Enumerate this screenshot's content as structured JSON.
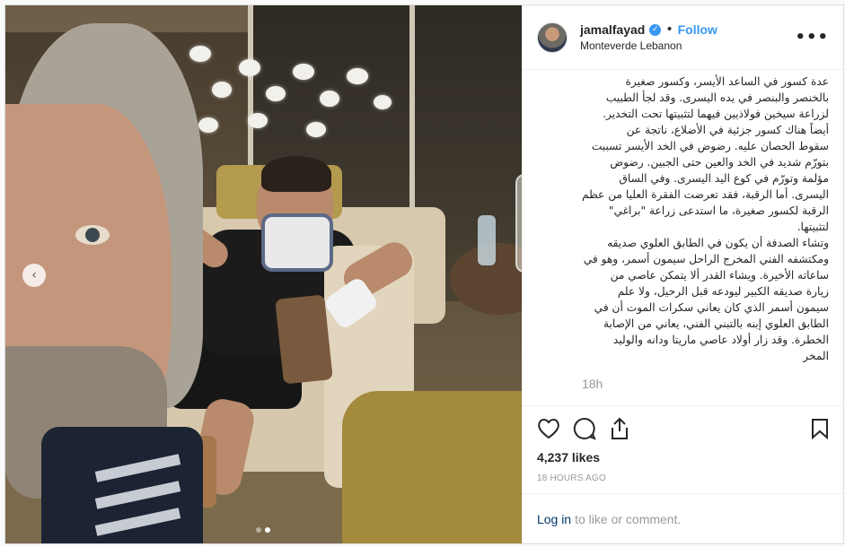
{
  "post": {
    "username": "jamalfayad",
    "verified_icon": "verified-badge-icon",
    "separator": "•",
    "follow_label": "Follow",
    "location": "Monteverde Lebanon",
    "more_label": "•••"
  },
  "media": {
    "prev_arrow": "‹",
    "carousel_dots": 2,
    "active_dot": 2
  },
  "caption": {
    "lines": [
      "عدة كسور في الساعد الأيسر، وكسور صغيرة",
      "بالخنصر والبنصر في يده اليسرى. وقد لجأ الطبيب",
      "لزراعة سيخين فولاذيين فيهما لتثبيتها تحت التخدير.",
      "أيضاً هناك كسور جزئية في الأضلاع، ناتجة عن",
      "سقوط الحصان عليه. رضوض في الخد الأيسر تسببت",
      "بتورّم شديد في الخد والعين حتى الجبين. رضوض",
      "مؤلمة وتورّم في كوع اليد اليسرى. وفي الساق",
      "اليسرى. أما الرقبة، فقد تعرضت الفقرة العليا من عظم",
      "الرقبة لكسور صغيرة، ما استدعى زراعة \"براغي\"",
      "لتثبيتها.",
      "وتشاء الصدفة أن يكون في الطابق العلوي صديقه",
      "ومكتشفه الفني المخرج الراحل سيمون أسمر، وهو في",
      "ساعاته الأخيرة. ويشاء القدر ألا يتمكن عاصي من",
      "زيارة صديقه الكبير ليودعه قبل الرحيل، ولا علم",
      "سيمون أسمر الذي كان يعاني سكرات الموت أن في",
      "الطابق العلوي إبنه بالتبني الفني، يعاني من الإصابة",
      "الخطرة. وقد زار أولاد عاصي ماريتا ودانه والوليد",
      "المخر"
    ],
    "time": "18h"
  },
  "actions": {
    "like_icon": "heart-icon",
    "comment_icon": "comment-bubble-icon",
    "share_icon": "share-icon",
    "save_icon": "bookmark-icon"
  },
  "likes": "4,237 likes",
  "posted_ago": "18 HOURS AGO",
  "login": {
    "link": "Log in",
    "rest": "to like or comment."
  },
  "colors": {
    "accent": "#3897f0",
    "muted": "#999999",
    "link": "#003569"
  }
}
